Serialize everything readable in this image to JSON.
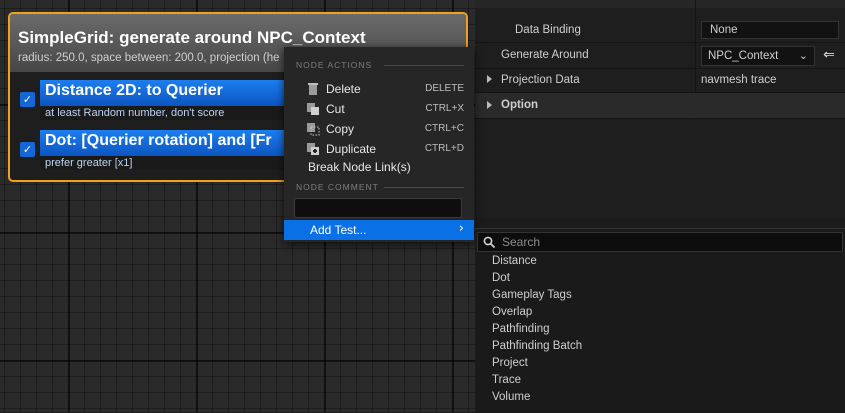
{
  "node": {
    "title": "SimpleGrid: generate around NPC_Context",
    "subtitle": "radius: 250.0, space between: 200.0, projection (he",
    "tests": [
      {
        "title": "Distance 2D: to Querier",
        "subtitle": "at least Random number, don't score",
        "checked": true
      },
      {
        "title": "Dot: [Querier rotation] and [Fr",
        "subtitle": "prefer greater [x1]",
        "checked": true
      }
    ]
  },
  "details": {
    "rows": [
      {
        "label": "Data Binding",
        "value": "None"
      },
      {
        "label": "Generate Around",
        "value": "NPC_Context"
      },
      {
        "label": "Projection Data",
        "value": "navmesh trace"
      },
      {
        "label": "Option",
        "value": ""
      }
    ]
  },
  "context_menu": {
    "node_actions_header": "NODE ACTIONS",
    "items": [
      {
        "label": "Delete",
        "shortcut": "DELETE",
        "icon": "trash-icon"
      },
      {
        "label": "Cut",
        "shortcut": "CTRL+X",
        "icon": "cut-icon"
      },
      {
        "label": "Copy",
        "shortcut": "CTRL+C",
        "icon": "copy-icon"
      },
      {
        "label": "Duplicate",
        "shortcut": "CTRL+D",
        "icon": "duplicate-icon"
      }
    ],
    "break_links_label": "Break Node Link(s)",
    "node_comment_header": "NODE COMMENT",
    "comment_value": "",
    "add_test_label": "Add Test..."
  },
  "submenu": {
    "search_placeholder": "Search",
    "items": [
      "Distance",
      "Dot",
      "Gameplay Tags",
      "Overlap",
      "Pathfinding",
      "Pathfinding Batch",
      "Project",
      "Trace",
      "Volume"
    ]
  },
  "colors": {
    "selection_border": "#f0a01c",
    "test_header_blue": "#1d7ef0",
    "menu_highlight": "#0a70e6"
  }
}
